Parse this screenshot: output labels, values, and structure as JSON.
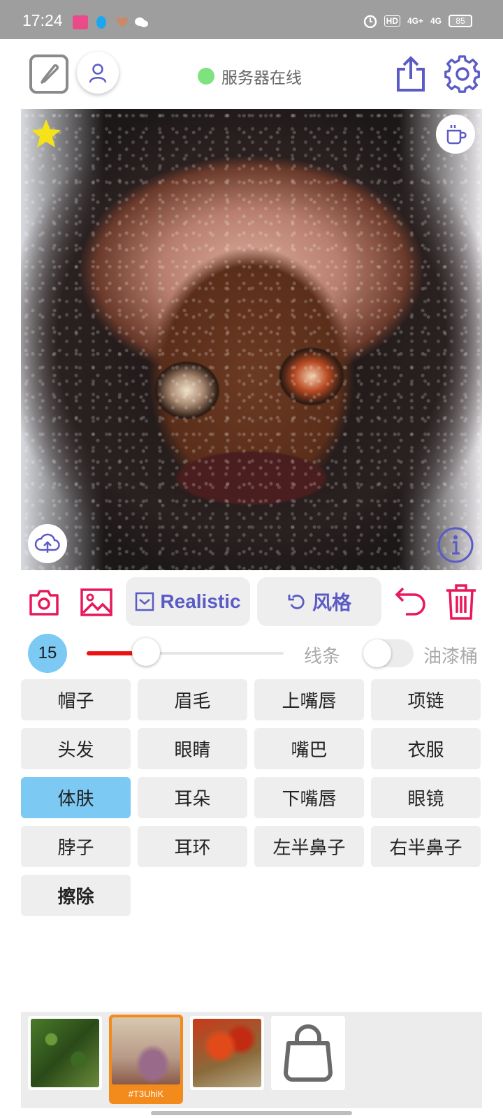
{
  "status_bar": {
    "time": "17:24",
    "hd_label": "HD",
    "net1": "4G+",
    "net2": "4G",
    "battery": "85"
  },
  "header": {
    "server_status": "服务器在线",
    "server_color": "#7ee27e"
  },
  "toolbar": {
    "realistic_label": "Realistic",
    "style_label": "风格",
    "accent_color": "#5b5bc6",
    "action_color": "#e8185a"
  },
  "brush": {
    "size": "15",
    "slider_fraction": 0.3,
    "line_label": "线条",
    "bucket_label": "油漆桶",
    "bucket_enabled": false
  },
  "parts": [
    {
      "label": "帽子",
      "selected": false
    },
    {
      "label": "眉毛",
      "selected": false
    },
    {
      "label": "上嘴唇",
      "selected": false
    },
    {
      "label": "项链",
      "selected": false
    },
    {
      "label": "头发",
      "selected": false
    },
    {
      "label": "眼睛",
      "selected": false
    },
    {
      "label": "嘴巴",
      "selected": false
    },
    {
      "label": "衣服",
      "selected": false
    },
    {
      "label": "体肤",
      "selected": true
    },
    {
      "label": "耳朵",
      "selected": false
    },
    {
      "label": "下嘴唇",
      "selected": false
    },
    {
      "label": "眼镜",
      "selected": false
    },
    {
      "label": "脖子",
      "selected": false
    },
    {
      "label": "耳环",
      "selected": false
    },
    {
      "label": "左半鼻子",
      "selected": false
    },
    {
      "label": "右半鼻子",
      "selected": false
    },
    {
      "label": "擦除",
      "selected": false
    }
  ],
  "gallery": {
    "selected_caption": "#T3UhiK"
  }
}
